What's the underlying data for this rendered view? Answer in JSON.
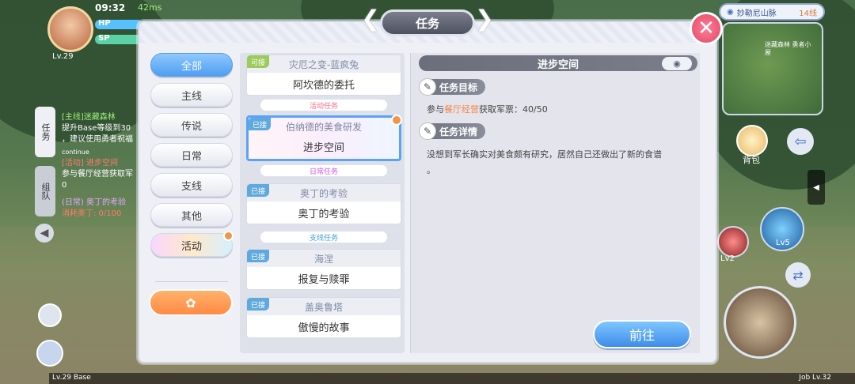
{
  "hud": {
    "time": "09:32",
    "ping": "42ms",
    "level": "Lv.29",
    "hp_label": "HP",
    "sp_label": "SP",
    "location": "妙勒尼山脉",
    "channel": "14线",
    "minimap_label": "迷藏森林 勇者小屋",
    "bag_label": "背包",
    "skill1": "Lv5",
    "skill2": "Lv2",
    "base_level": "Lv.29 Base",
    "job_level": "Job Lv.32",
    "side_tab_mission": "任务",
    "side_tab_team": "组队",
    "side_quests": [
      {
        "line1": "[主线]迷藏森林",
        "line2": "提升Base等级到30",
        "line3": "，建议使用勇者祝福"
      },
      {
        "tag": "continue",
        "line1": "[活动] 进步空间",
        "line2": "参与餐厅经营获取军",
        "line3": "0"
      },
      {
        "line1": "(日常) 奥丁的考验",
        "line2": "消耗奥丁: 0/100"
      }
    ]
  },
  "modal": {
    "title": "任务",
    "close_label": "✕",
    "categories": [
      "全部",
      "主线",
      "传说",
      "日常",
      "支线",
      "其他",
      "活动"
    ],
    "quests": [
      {
        "tag": "可接",
        "name": "灾厄之变-蓝疯兔",
        "sub": "阿坎德的委托"
      },
      {
        "section": "活动任务"
      },
      {
        "tag": "已接",
        "name": "伯纳德的美食研发",
        "sub": "进步空间"
      },
      {
        "section": "日常任务"
      },
      {
        "tag": "已接",
        "name": "奥丁的考验",
        "sub": "奥丁的考验"
      },
      {
        "section": "支线任务"
      },
      {
        "tag": "已接",
        "name": "海涅",
        "sub": "报复与赎罪"
      },
      {
        "tag": "已接",
        "name": "盖奥鲁塔",
        "sub": "傲慢的故事"
      }
    ],
    "detail": {
      "title": "进步空间",
      "goal_header": "任务目标",
      "goal_pre": "参与",
      "goal_highlight": "餐厅经营",
      "goal_post": "获取军票：40/50",
      "info_header": "任务详情",
      "info_text": "没想到军长确实对美食颇有研究，居然自己还做出了新的食谱",
      "info_text2": "。",
      "go_button": "前往"
    }
  },
  "colors": {
    "accent": "#4f9ef2",
    "highlight": "#f0864a",
    "close": "#e24867"
  }
}
